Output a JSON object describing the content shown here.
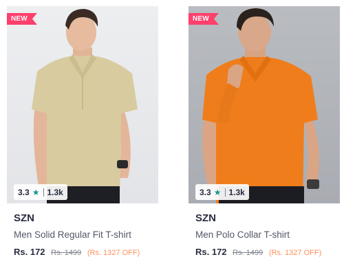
{
  "products": [
    {
      "badge": "NEW",
      "rating": "3.3",
      "rating_icon": "star-icon",
      "rating_count": "1.3k",
      "brand": "SZN",
      "name": "Men Solid Regular Fit T-shirt",
      "price": "Rs. 172",
      "mrp": "Rs. 1499",
      "discount": "(Rs. 1327 OFF)",
      "shirt_color": "#d8cb9f"
    },
    {
      "badge": "NEW",
      "rating": "3.3",
      "rating_icon": "star-icon",
      "rating_count": "1.3k",
      "brand": "SZN",
      "name": "Men Polo Collar T-shirt",
      "price": "Rs. 172",
      "mrp": "Rs. 1499",
      "discount": "(Rs. 1327 OFF)",
      "shirt_color": "#f07d1c"
    }
  ],
  "colors": {
    "badge": "#ff3f6c",
    "star": "#14958f",
    "discount": "#ff905a"
  }
}
